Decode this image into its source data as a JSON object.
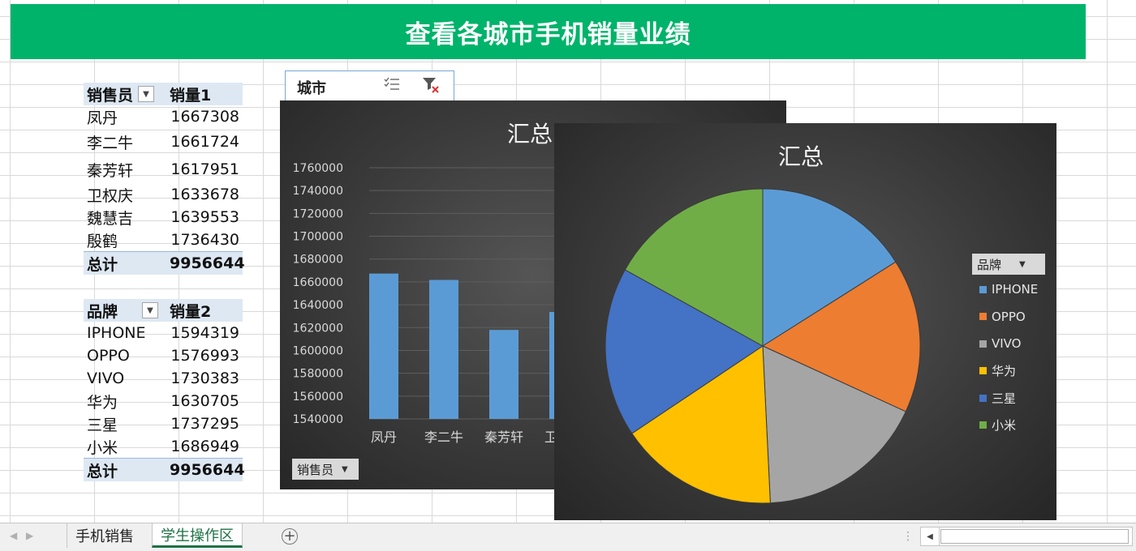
{
  "banner": {
    "title": "查看各城市手机销量业绩"
  },
  "pivot_sales": {
    "headers": [
      "销售员",
      "销量1"
    ],
    "rows": [
      {
        "name": "凤丹",
        "value": "1667308"
      },
      {
        "name": "李二牛",
        "value": "1661724"
      },
      {
        "name": "秦芳轩",
        "value": "1617951"
      },
      {
        "name": "卫权庆",
        "value": "1633678"
      },
      {
        "name": "魏慧吉",
        "value": "1639553"
      },
      {
        "name": "殷鹤",
        "value": "1736430"
      }
    ],
    "total_label": "总计",
    "total_value": "9956644"
  },
  "pivot_brand": {
    "headers": [
      "品牌",
      "销量2"
    ],
    "rows": [
      {
        "name": "IPHONE",
        "value": "1594319"
      },
      {
        "name": "OPPO",
        "value": "1576993"
      },
      {
        "name": "VIVO",
        "value": "1730383"
      },
      {
        "name": "华为",
        "value": "1630705"
      },
      {
        "name": "三星",
        "value": "1737295"
      },
      {
        "name": "小米",
        "value": "1686949"
      }
    ],
    "total_label": "总计",
    "total_value": "9956644"
  },
  "slicer": {
    "title": "城市"
  },
  "bar_field_button": "销售员",
  "pie_field_button": "品牌",
  "tabs": {
    "sheet1": "手机销售",
    "sheet2": "学生操作区"
  },
  "colors": {
    "banner": "#00b36a",
    "bar": "#5b9bd5",
    "pie": [
      "#5b9bd5",
      "#ed7d31",
      "#a5a5a5",
      "#ffc000",
      "#4472c4",
      "#70ad47"
    ]
  },
  "chart_data": [
    {
      "type": "bar",
      "title": "汇总",
      "categories": [
        "凤丹",
        "李二牛",
        "秦芳轩",
        "卫权庆"
      ],
      "values": [
        1667308,
        1661724,
        1617951,
        1633678
      ],
      "ylim": [
        1540000,
        1760000
      ],
      "yticks": [
        1540000,
        1560000,
        1580000,
        1600000,
        1620000,
        1640000,
        1660000,
        1680000,
        1700000,
        1720000,
        1740000,
        1760000
      ],
      "xlabel": "",
      "ylabel": "",
      "grid": true
    },
    {
      "type": "pie",
      "title": "汇总",
      "categories": [
        "IPHONE",
        "OPPO",
        "VIVO",
        "华为",
        "三星",
        "小米"
      ],
      "values": [
        1594319,
        1576993,
        1730383,
        1630705,
        1737295,
        1686949
      ],
      "legend": "right"
    }
  ]
}
